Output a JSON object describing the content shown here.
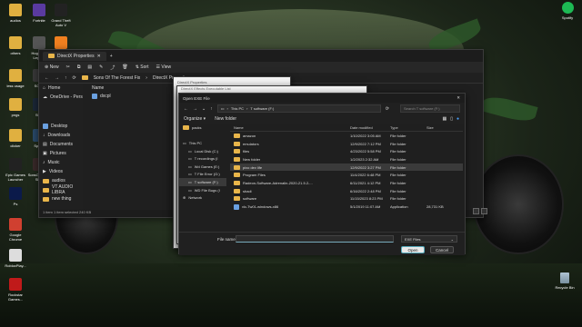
{
  "desktop": {
    "left_icons": [
      {
        "label": "audios",
        "color": "#e0b040"
      },
      {
        "label": "Fortnite",
        "color": "#5a3aa0"
      },
      {
        "label": "Grand Theft Auto V",
        "color": "#222222"
      },
      {
        "label": "others",
        "color": "#e0b040"
      },
      {
        "label": "Hogwarts Legacy",
        "color": "#555555"
      },
      {
        "label": "FiveM",
        "color": "#f08020"
      },
      {
        "label": "less usage",
        "color": "#e0b040"
      },
      {
        "label": "SOTF",
        "color": "#3a3a3a"
      },
      {
        "label": "pngs",
        "color": "#e0b040"
      },
      {
        "label": "Stea",
        "color": "#1b2838"
      },
      {
        "label": "clicker",
        "color": "#e0b040"
      },
      {
        "label": "Space",
        "color": "#2a4a6a"
      },
      {
        "label": "Epic Games Launcher",
        "color": "#222222"
      },
      {
        "label": "SonsOf The... Shor",
        "color": "#3a2a2a"
      },
      {
        "label": "Ps",
        "color": "#0b1a4a"
      },
      {
        "label": "Google Chrome",
        "color": "#d04030"
      },
      {
        "label": "RobloxPlay...",
        "color": "#dddddd"
      },
      {
        "label": "Rockstar Games...",
        "color": "#c01a1a"
      }
    ],
    "spotify_label": "Spotify",
    "recycle_label": "Recycle Bin"
  },
  "explorer": {
    "tab_title": "DirectX Properties",
    "toolbar": {
      "new": "New",
      "sort": "Sort",
      "view": "View"
    },
    "breadcrumb": [
      "Sons Of The Forest Fix",
      "DirectX Properties"
    ],
    "sidebar": [
      "Home",
      "OneDrive - Pers"
    ],
    "column_name": "Name",
    "file": "dxcpl",
    "sidebar_lower": [
      "Desktop",
      "Downloads",
      "Documents",
      "Pictures",
      "Music",
      "Videos",
      "audios",
      "VT AUDIO LIBRA",
      "new thing"
    ],
    "status": "1 item   1 item selected  240 KB"
  },
  "props_back": {
    "title": "DirectX Properties"
  },
  "props_mid": {
    "title": "DirectX Effects Executable List"
  },
  "dialog": {
    "title": "Open EXE File",
    "address": [
      "This PC",
      "T software (F:)"
    ],
    "search_placeholder": "Search T software (F:)",
    "organize": "Organize",
    "new_folder": "New folder",
    "sidebar": [
      {
        "label": "packs",
        "icon": "folder"
      },
      {
        "label": "",
        "icon": ""
      },
      {
        "label": "This PC",
        "icon": "pc"
      },
      {
        "label": "Local Disk (C:)",
        "icon": "drive"
      },
      {
        "label": "T recordings (I",
        "icon": "drive"
      },
      {
        "label": "Wd Games (E:)",
        "icon": "drive"
      },
      {
        "label": "T File Error (G:)",
        "icon": "drive"
      },
      {
        "label": "T software (F:)",
        "icon": "drive"
      },
      {
        "label": "WD File Bugs (I",
        "icon": "drive"
      },
      {
        "label": "Network",
        "icon": "network"
      }
    ],
    "columns": {
      "name": "Name",
      "date": "Date modified",
      "type": "Type",
      "size": "Size"
    },
    "files": [
      {
        "name": "amazon",
        "date": "1/10/2022 3:05 AM",
        "type": "File folder",
        "size": "",
        "kind": "folder"
      },
      {
        "name": "emulators",
        "date": "12/9/2022 7:12 PM",
        "type": "File folder",
        "size": "",
        "kind": "folder"
      },
      {
        "name": "files",
        "date": "4/23/2022 5:58 PM",
        "type": "File folder",
        "size": "",
        "kind": "folder"
      },
      {
        "name": "New folder",
        "date": "1/2/2023 2:32 AM",
        "type": "File folder",
        "size": "",
        "kind": "folder"
      },
      {
        "name": "pixo dev life",
        "date": "12/9/2022 3:27 PM",
        "type": "File folder",
        "size": "",
        "kind": "folder",
        "selected": true
      },
      {
        "name": "Program Files",
        "date": "11/4/2022 6:48 PM",
        "type": "File folder",
        "size": "",
        "kind": "folder"
      },
      {
        "name": "Radeon-Software-Adrenalin-2020-21.5.2-...",
        "date": "6/11/2021 4:12 PM",
        "type": "File folder",
        "size": "",
        "kind": "folder"
      },
      {
        "name": "shadi",
        "date": "6/16/2022 2:48 PM",
        "type": "File folder",
        "size": "",
        "kind": "folder"
      },
      {
        "name": "software",
        "date": "11/15/2023 8:23 PM",
        "type": "File folder",
        "size": "",
        "kind": "folder"
      },
      {
        "name": "vlc-Tw01-windows-x86",
        "date": "5/1/2019 11:07 AM",
        "type": "Application",
        "size": "28,731 KB",
        "kind": "app"
      }
    ],
    "file_name_label": "File name:",
    "file_name_value": "",
    "file_type": "EXE Files",
    "open": "Open",
    "cancel": "Cancel"
  }
}
